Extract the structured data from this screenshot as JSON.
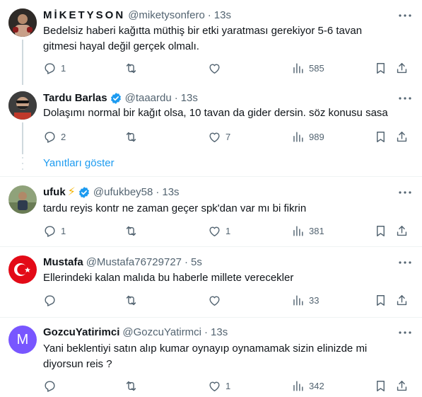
{
  "tweets": [
    {
      "name": "MİKETYSON",
      "handle": "@miketysonfero",
      "time": "13s",
      "verified": false,
      "text": "Bedelsiz haberi kağıtta müthiş bir etki yaratması gerekiyor 5-6 tavan gitmesi hayal değil gerçek olmalı.",
      "replies": "1",
      "retweets": "",
      "likes": "",
      "views": "585"
    },
    {
      "name": "Tardu Barlas",
      "handle": "@taaardu",
      "time": "13s",
      "verified": true,
      "text": "Dolaşımı normal bir kağıt olsa, 10 tavan da gider dersin. söz konusu sasa",
      "replies": "2",
      "retweets": "",
      "likes": "7",
      "views": "989"
    },
    {
      "name": "ufuk",
      "handle": "@ufukbey58",
      "time": "13s",
      "verified": true,
      "bolt": "⚡",
      "text": "tardu reyis kontr ne zaman geçer spk'dan var mı bi fikrin",
      "replies": "1",
      "retweets": "",
      "likes": "1",
      "views": "381"
    },
    {
      "name": "Mustafa",
      "handle": "@Mustafa76729727",
      "time": "5s",
      "verified": false,
      "text": "Ellerindeki kalan malıda bu haberle millete verecekler",
      "replies": "",
      "retweets": "",
      "likes": "",
      "views": "33"
    },
    {
      "name": "GozcuYatirimci",
      "handle": "@GozcuYatirmci",
      "time": "13s",
      "verified": false,
      "avatar_letter": "M",
      "text": "Yani beklentiyi satın alıp kumar oynayıp oynamamak sizin elinizde mi diyorsun reis ?",
      "replies": "",
      "retweets": "",
      "likes": "1",
      "views": "342"
    }
  ],
  "show_replies_label": "Yanıtları göster",
  "separator": "·",
  "colors": {
    "text": "#0f1419",
    "muted": "#536471",
    "link": "#1d9bf0",
    "verified": "#1d9bf0",
    "divider": "#eff3f4",
    "avatar_m": "#7856ff"
  },
  "icons": [
    "more-icon",
    "reply-icon",
    "retweet-icon",
    "like-icon",
    "views-icon",
    "bookmark-icon",
    "share-icon",
    "verified-badge-icon"
  ]
}
